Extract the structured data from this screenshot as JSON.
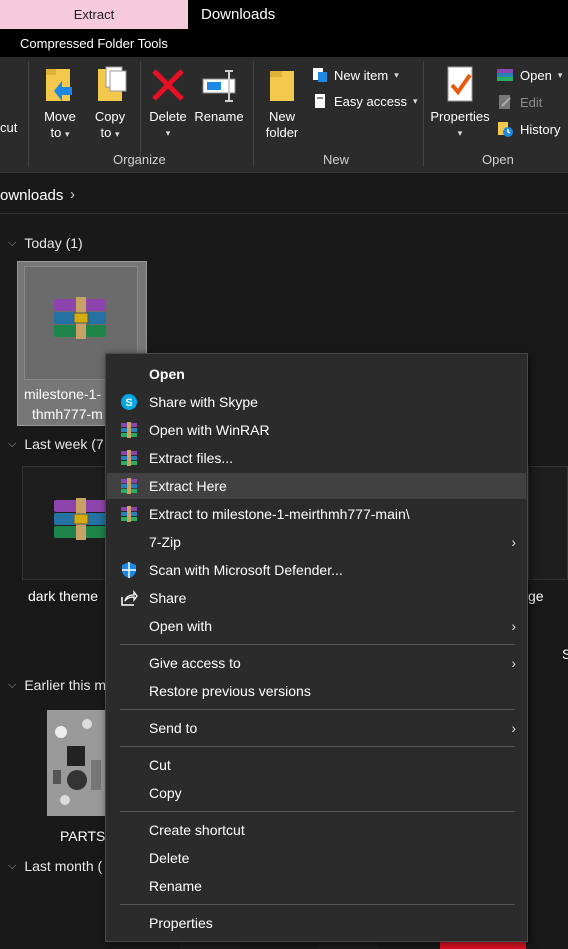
{
  "titlebar": {
    "tab_extract": "Extract",
    "tab_tools": "Compressed Folder Tools",
    "window_title": "Downloads"
  },
  "ribbon": {
    "cut_fragment": "cut",
    "move_to": [
      "Move",
      "to"
    ],
    "copy_to": [
      "Copy",
      "to"
    ],
    "delete": "Delete",
    "rename": "Rename",
    "new_folder": [
      "New",
      "folder"
    ],
    "new_item": "New item",
    "easy_access": "Easy access",
    "properties": "Properties",
    "open": "Open",
    "edit": "Edit",
    "history": "History",
    "group_organize": "Organize",
    "group_new": "New",
    "group_open": "Open"
  },
  "address": {
    "path": "ownloads",
    "chevron": "›"
  },
  "groups": {
    "today": "Today (1)",
    "last_week": "Last week (7",
    "earlier": "Earlier this m",
    "last_month": "Last month ("
  },
  "files": {
    "selected_name_line1": "milestone-1-",
    "selected_name_line2": "thmh777-m",
    "dark_theme": "dark theme",
    "parts": "PARTS",
    "partial_right": "ge",
    "partial_s": "S"
  },
  "menu": {
    "items": [
      {
        "label": "Open"
      },
      {
        "label": "Share with Skype"
      },
      {
        "label": "Open with WinRAR"
      },
      {
        "label": "Extract files..."
      },
      {
        "label": "Extract Here"
      },
      {
        "label": "Extract to milestone-1-meirthmh777-main\\"
      },
      {
        "label": "7-Zip"
      },
      {
        "label": "Scan with Microsoft Defender..."
      },
      {
        "label": "Share"
      },
      {
        "label": "Open with"
      },
      {
        "label": "Give access to"
      },
      {
        "label": "Restore previous versions"
      },
      {
        "label": "Send to"
      },
      {
        "label": "Cut"
      },
      {
        "label": "Copy"
      },
      {
        "label": "Create shortcut"
      },
      {
        "label": "Delete"
      },
      {
        "label": "Rename"
      },
      {
        "label": "Properties"
      }
    ],
    "submenu_arrow": "›"
  },
  "colors": {
    "tab_accent": "#f6c9dd",
    "background": "#191919",
    "ribbon": "#2b2b2b",
    "menu_highlight": "#414141",
    "delete_red": "#e81123",
    "skype_blue": "#00a8e8"
  }
}
